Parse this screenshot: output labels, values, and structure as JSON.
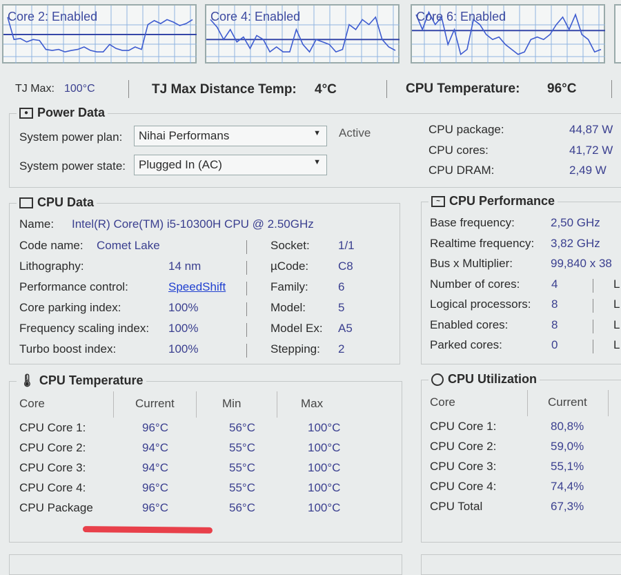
{
  "graphs": [
    {
      "label": "Core 2: Enabled",
      "avg": 50,
      "values": [
        85,
        40,
        42,
        35,
        40,
        38,
        20,
        18,
        20,
        15,
        18,
        20,
        25,
        18,
        15,
        15,
        30,
        22,
        18,
        18,
        25,
        20,
        70,
        78,
        72,
        80,
        75,
        68,
        72,
        80
      ]
    },
    {
      "label": "Core 4: Enabled",
      "avg": 40,
      "values": [
        80,
        65,
        40,
        60,
        35,
        45,
        22,
        48,
        40,
        15,
        25,
        15,
        15,
        60,
        30,
        15,
        40,
        35,
        30,
        15,
        20,
        70,
        60,
        80,
        70,
        85,
        40,
        25,
        18
      ]
    },
    {
      "label": "Core 6: Enabled",
      "avg": 58,
      "values": [
        90,
        60,
        95,
        70,
        85,
        30,
        60,
        10,
        20,
        80,
        70,
        50,
        40,
        45,
        30,
        20,
        10,
        15,
        40,
        45,
        40,
        50,
        70,
        85,
        60,
        90,
        50,
        40,
        15,
        20
      ]
    }
  ],
  "status": {
    "tjmax_label": "TJ Max:",
    "tjmax_value": "100°C",
    "distance_label": "TJ Max Distance Temp:",
    "distance_value": "4°C",
    "cputemp_label": "CPU Temperature:",
    "cputemp_value": "96°C"
  },
  "power": {
    "title": "Power Data",
    "plan_label": "System power plan:",
    "plan_value": "Nihai Performans",
    "plan_status": "Active",
    "state_label": "System power state:",
    "state_value": "Plugged In (AC)",
    "readings": [
      {
        "label": "CPU package:",
        "value": "44,87 W"
      },
      {
        "label": "CPU cores:",
        "value": "41,72 W"
      },
      {
        "label": "CPU DRAM:",
        "value": "2,49 W"
      }
    ]
  },
  "cpu": {
    "title": "CPU Data",
    "name_label": "Name:",
    "name_value": "Intel(R) Core(TM) i5-10300H CPU @ 2.50GHz",
    "codename_label": "Code name:",
    "codename_value": "Comet Lake",
    "left": [
      {
        "label": "Lithography:",
        "value": "14 nm"
      },
      {
        "label": "Performance control:",
        "value": "SpeedShift"
      },
      {
        "label": "Core parking index:",
        "value": "100%"
      },
      {
        "label": "Frequency scaling index:",
        "value": "100%"
      },
      {
        "label": "Turbo boost index:",
        "value": "100%"
      }
    ],
    "right": [
      {
        "label": "Socket:",
        "value": "1/1"
      },
      {
        "label": "µCode:",
        "value": "C8"
      },
      {
        "label": "Family:",
        "value": "6"
      },
      {
        "label": "Model:",
        "value": "5"
      },
      {
        "label": "Model Ex:",
        "value": "A5"
      },
      {
        "label": "Stepping:",
        "value": "2"
      }
    ]
  },
  "perf": {
    "title": "CPU Performance",
    "rows": [
      {
        "label": "Base frequency:",
        "value": "2,50 GHz"
      },
      {
        "label": "Realtime frequency:",
        "value": "3,82 GHz"
      },
      {
        "label": "Bus x Multiplier:",
        "value": "99,840 x 38"
      },
      {
        "label": "Number of cores:",
        "value": "4"
      },
      {
        "label": "Logical processors:",
        "value": "8"
      },
      {
        "label": "Enabled cores:",
        "value": "8"
      },
      {
        "label": "Parked cores:",
        "value": "0"
      }
    ],
    "trunc": "L"
  },
  "temp": {
    "title": "CPU Temperature",
    "headers": [
      "Core",
      "Current",
      "Min",
      "Max"
    ],
    "rows": [
      [
        "CPU Core 1:",
        "96°C",
        "56°C",
        "100°C"
      ],
      [
        "CPU Core 2:",
        "94°C",
        "55°C",
        "100°C"
      ],
      [
        "CPU Core 3:",
        "94°C",
        "55°C",
        "100°C"
      ],
      [
        "CPU Core 4:",
        "96°C",
        "55°C",
        "100°C"
      ],
      [
        "CPU Package",
        "96°C",
        "56°C",
        "100°C"
      ]
    ]
  },
  "util": {
    "title": "CPU Utilization",
    "headers": [
      "Core",
      "Current"
    ],
    "rows": [
      [
        "CPU Core 1:",
        "80,8%"
      ],
      [
        "CPU Core 2:",
        "59,0%"
      ],
      [
        "CPU Core 3:",
        "55,1%"
      ],
      [
        "CPU Core 4:",
        "74,4%"
      ],
      [
        "CPU Total",
        "67,3%"
      ]
    ]
  },
  "colors": {
    "graph_line": "#3d5bd0",
    "value_text": "#3a3f8f",
    "annotation": "#e8404a"
  }
}
